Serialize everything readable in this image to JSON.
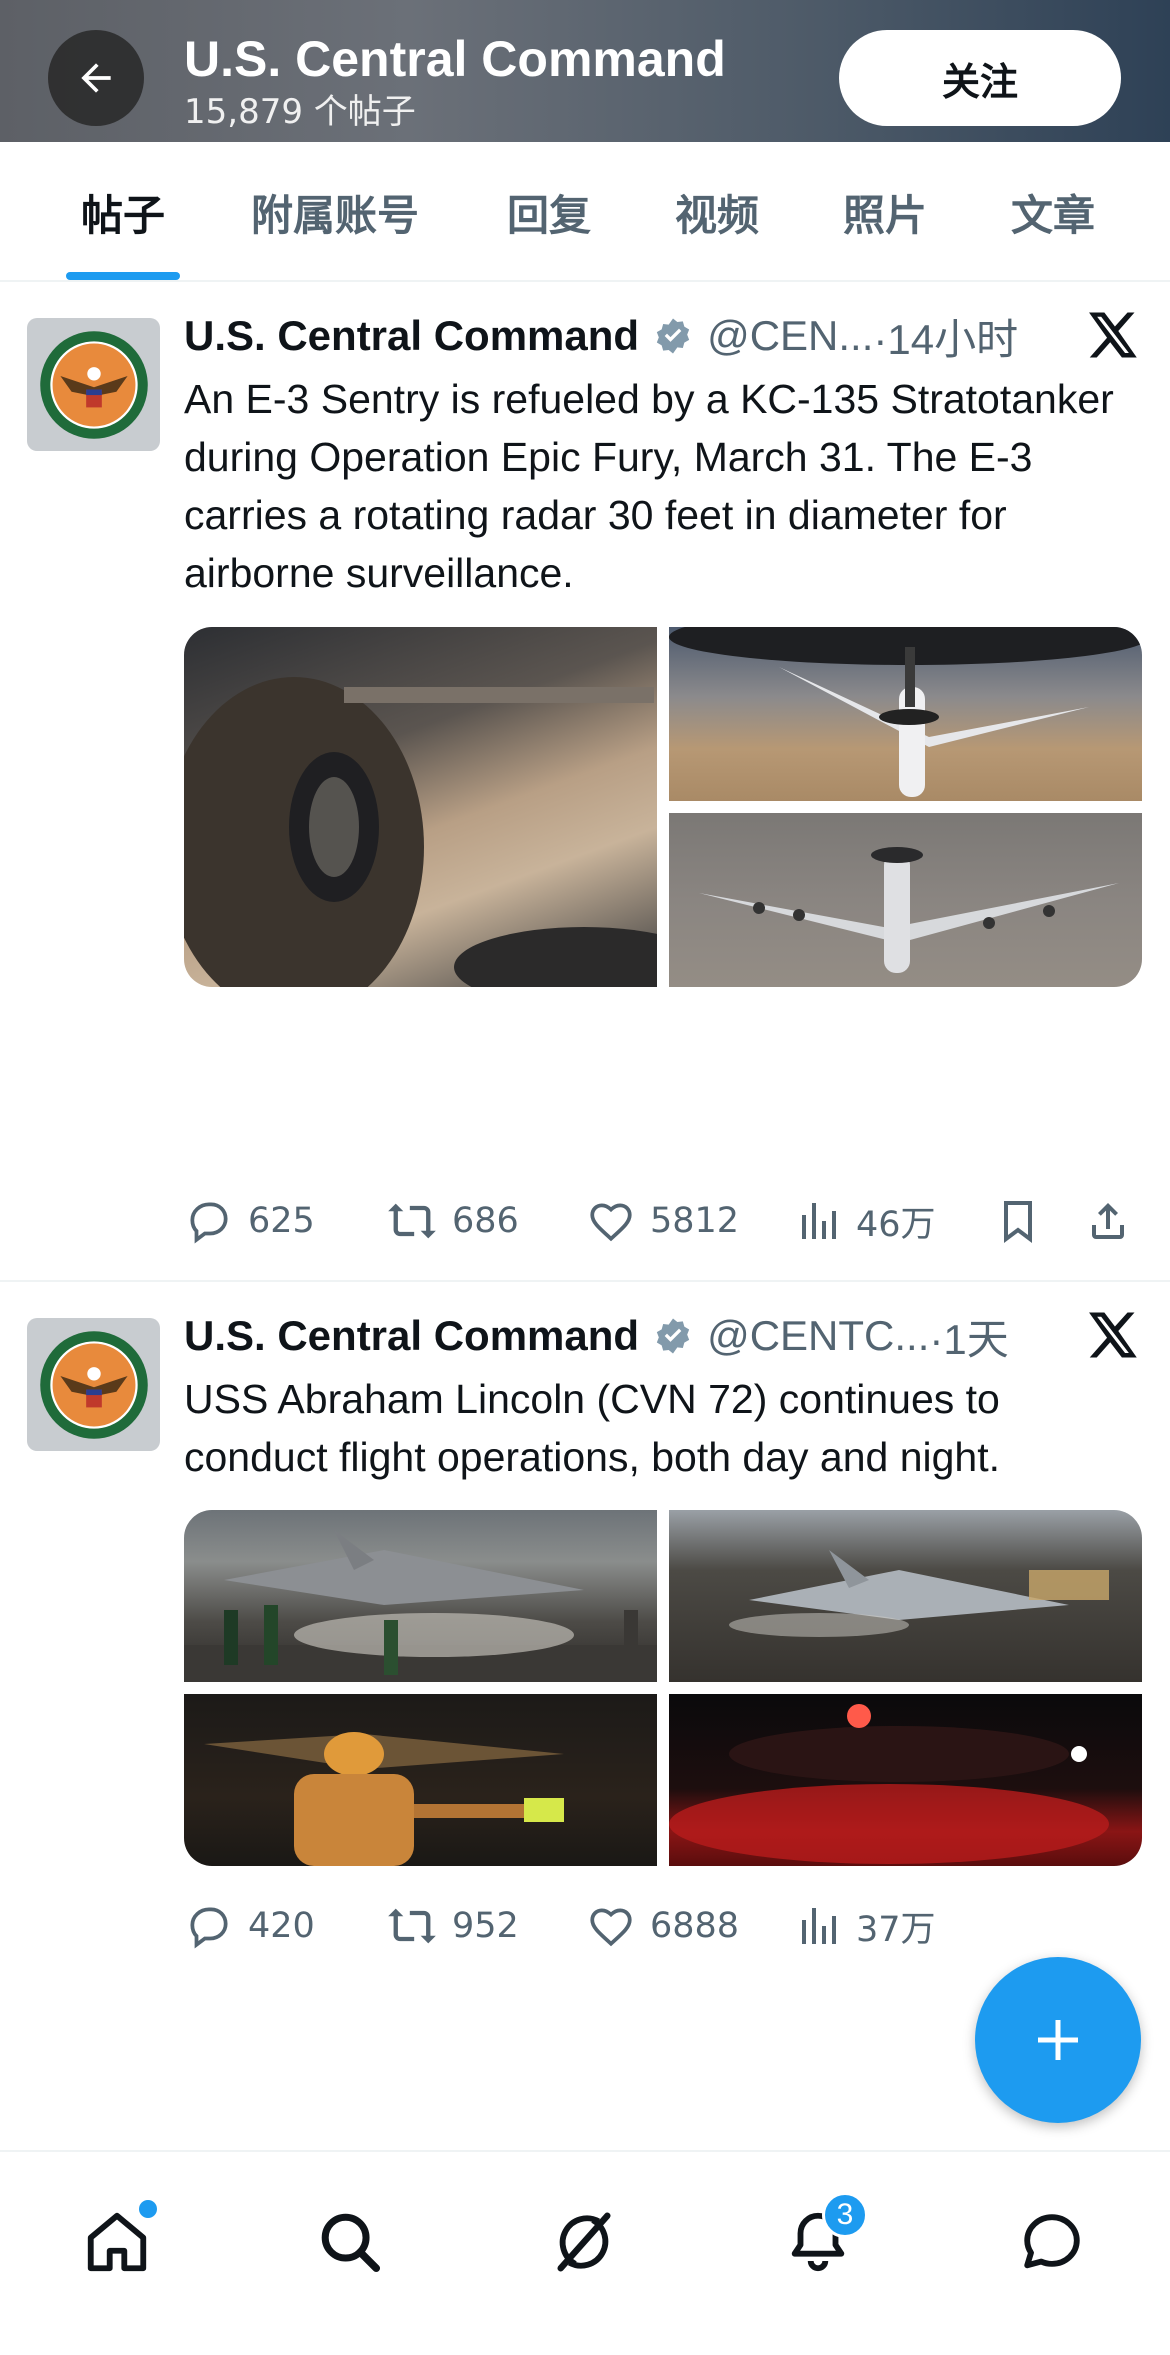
{
  "header": {
    "title": "U.S. Central Command",
    "post_count": "15,879 个帖子",
    "follow_label": "关注"
  },
  "tabs": [
    {
      "label": "帖子"
    },
    {
      "label": "附属账号"
    },
    {
      "label": "回复"
    },
    {
      "label": "视频"
    },
    {
      "label": "照片"
    },
    {
      "label": "文章"
    }
  ],
  "posts": [
    {
      "author": "U.S. Central Command",
      "handle": "@CEN...",
      "time": "·14小时",
      "text": "An E-3 Sentry is refueled by a KC-135 Stratotanker during Operation Epic Fury, March 31. The E-3 carries a rotating radar 30 feet in diameter for airborne surveillance.",
      "stats": {
        "replies": "625",
        "reposts": "686",
        "likes": "5812",
        "views": "46万"
      }
    },
    {
      "author": "U.S. Central Command",
      "handle": "@CENTC...",
      "time": "·1天",
      "text": "USS Abraham Lincoln (CVN 72) continues to conduct flight operations, both day and night.",
      "stats": {
        "replies": "420",
        "reposts": "952",
        "likes": "6888",
        "views": "37万"
      }
    }
  ],
  "bottom_nav": {
    "notifications_badge": "3"
  },
  "icons": [
    "back-arrow-icon",
    "verified-icon",
    "x-logo-icon",
    "reply-icon",
    "repost-icon",
    "like-icon",
    "views-icon",
    "bookmark-icon",
    "share-icon",
    "plus-icon",
    "home-icon",
    "search-icon",
    "grok-icon",
    "bell-icon",
    "message-icon"
  ],
  "colors": {
    "accent": "#1d9bf0",
    "text": "#0f1419",
    "muted": "#536471"
  }
}
